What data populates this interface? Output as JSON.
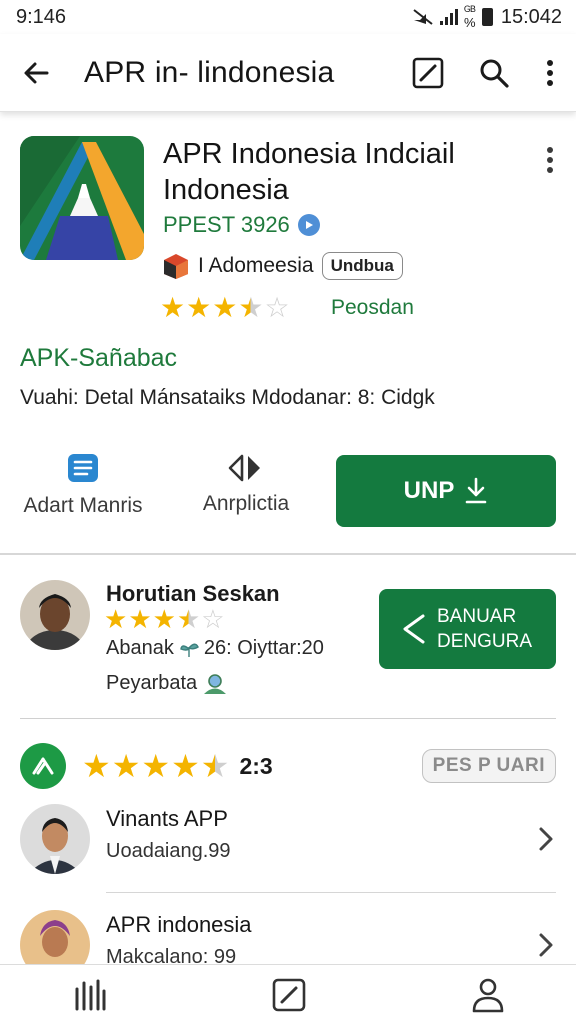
{
  "status_bar": {
    "time": "9:146",
    "battery_text": "15:042",
    "net_text": "ᴳᴮ\n%"
  },
  "app_bar": {
    "title": "APR in- lindonesia"
  },
  "app": {
    "name_line1": "APR Indonesia Indciail",
    "name_line2": "Indonesia",
    "publisher": "PPEST 3926",
    "developer": "I Adomeesia",
    "tag": "Undbua",
    "rating": 3.5,
    "rating_status": "Peosdan"
  },
  "apk": {
    "label": "APK-Sañabac",
    "description": "Vuahi: Detal Mánsataiks Mdodanar: 8: Cidgk"
  },
  "actions": {
    "first_label": "Adart Manris",
    "second_label": "Anrplictia",
    "install_label": "UNP"
  },
  "review": {
    "name": "Horutian Seskan",
    "rating": 3.5,
    "meta_line1": "Abanak",
    "meta_line1b": "26: Oiyttar:20",
    "meta_line2": "Peyarbata",
    "share_line1": "BANUAR",
    "share_line2": "DENGURA"
  },
  "summary": {
    "rating": 4.5,
    "score": "2:3",
    "pill": "PES P UARI"
  },
  "list": [
    {
      "title": "Vinants APP",
      "subtitle": "Uoadaiang.99"
    },
    {
      "title": "APR indonesia",
      "subtitle": "Makcalano: 99"
    }
  ],
  "colors": {
    "primary_green": "#147a3f",
    "accent_green": "#1f7a3c",
    "star": "#f4b400"
  },
  "icons": [
    "back-arrow-icon",
    "edit-icon",
    "search-icon",
    "more-vert-icon",
    "chat-icon",
    "audio-icon",
    "download-icon",
    "share-icon",
    "chevron-right-icon",
    "bars-icon",
    "profile-icon"
  ]
}
